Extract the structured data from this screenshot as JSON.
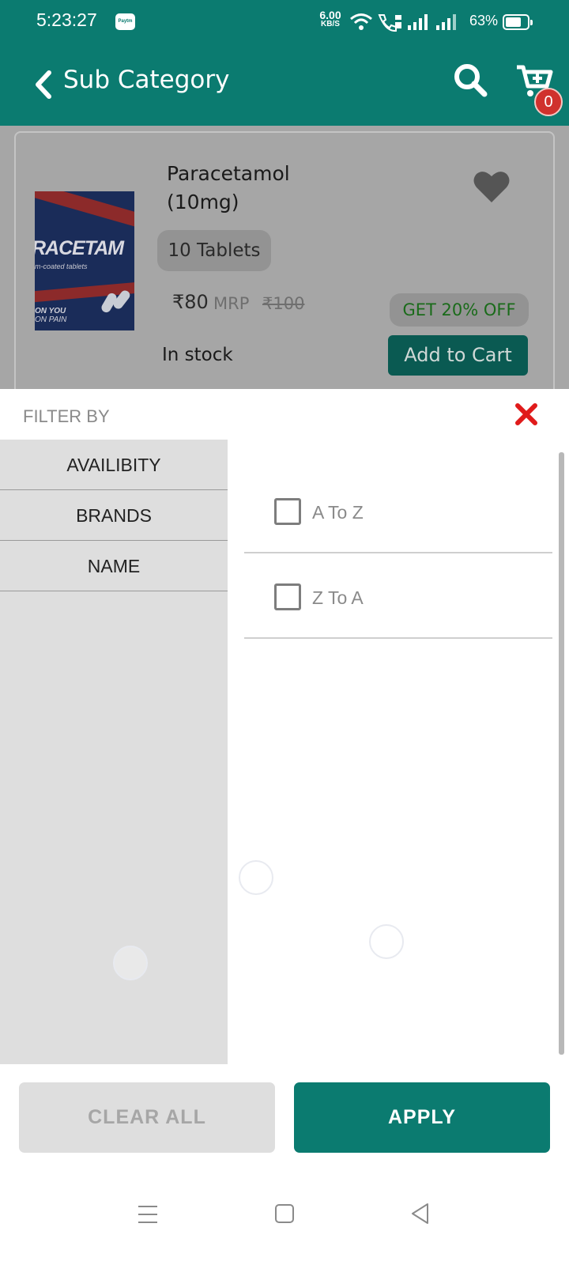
{
  "status_bar": {
    "time": "5:23:27",
    "paytm_label": "Paytm",
    "net_speed_value": "6.00",
    "net_speed_unit": "KB/S",
    "battery_percent": "63%",
    "icons": [
      "wifi-icon",
      "volte-call-icon",
      "signal-icon",
      "signal-icon",
      "battery-icon"
    ]
  },
  "app_bar": {
    "title": "Sub Category",
    "cart_count": "0",
    "icons": [
      "back-icon",
      "search-icon",
      "cart-icon"
    ]
  },
  "product": {
    "name_line1": "Paracetamol",
    "name_line2": "(10mg)",
    "pack": "10 Tablets",
    "price": "₹80",
    "mrp_label": "MRP",
    "mrp_value": "₹100",
    "discount": "GET 20% OFF",
    "stock": "In stock",
    "add_to_cart": "Add to Cart",
    "image_text": {
      "brand": "RACETAM",
      "sub": "m-coated tablets",
      "tag1": "ON YOU",
      "tag2": "ON PAIN"
    }
  },
  "filter": {
    "title": "FILTER BY",
    "categories": [
      "AVAILIBITY",
      "BRANDS",
      "NAME"
    ],
    "options": [
      {
        "label": "A To Z",
        "checked": false
      },
      {
        "label": "Z To A",
        "checked": false
      }
    ],
    "clear_all": "CLEAR ALL",
    "apply": "APPLY"
  },
  "nav_bar": {
    "icons": [
      "menu-icon",
      "home-icon",
      "back-nav-icon"
    ]
  },
  "colors": {
    "primary": "#0b7b70",
    "badge": "#d0312d",
    "close": "#e01b1b",
    "discount_text": "#1a6b1a"
  }
}
